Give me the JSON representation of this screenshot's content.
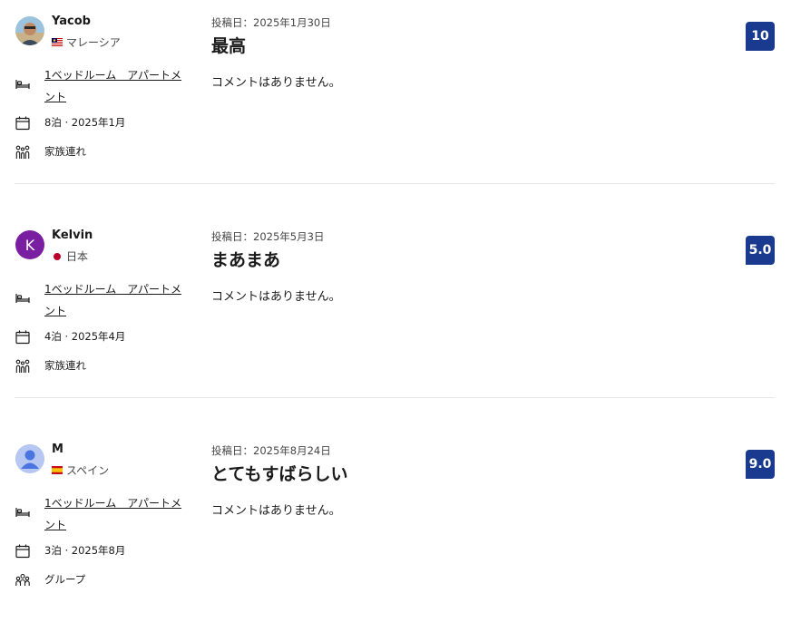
{
  "reviews": [
    {
      "name": "Yacob",
      "country": "マレーシア",
      "room": "1ベッドルーム　アパートメント",
      "stay": "8泊 · 2025年1月",
      "traveler": "家族連れ",
      "date": "投稿日：2025年1月30日",
      "title": "最高",
      "comment": "コメントはありません。",
      "score": "10",
      "avatar_icon": "user-photo"
    },
    {
      "name": "Kelvin",
      "country": "日本",
      "room": "1ベッドルーム　アパートメント",
      "stay": "4泊 · 2025年4月",
      "traveler": "家族連れ",
      "date": "投稿日：2025年5月3日",
      "title": "まあまあ",
      "comment": "コメントはありません。",
      "score": "5.0",
      "avatar_letter": "K"
    },
    {
      "name": "M",
      "country": "スペイン",
      "room": "1ベッドルーム　アパートメント",
      "stay": "3泊 · 2025年8月",
      "traveler": "グループ",
      "date": "投稿日：2025年8月24日",
      "title": "とてもすばらしい",
      "comment": "コメントはありません。",
      "score": "9.0",
      "avatar_icon": "default-user-icon"
    }
  ],
  "colors": {
    "score_bg": "#1a3a8f",
    "avatar_purple": "#7b1fa2",
    "divider": "#e7e7e7"
  }
}
